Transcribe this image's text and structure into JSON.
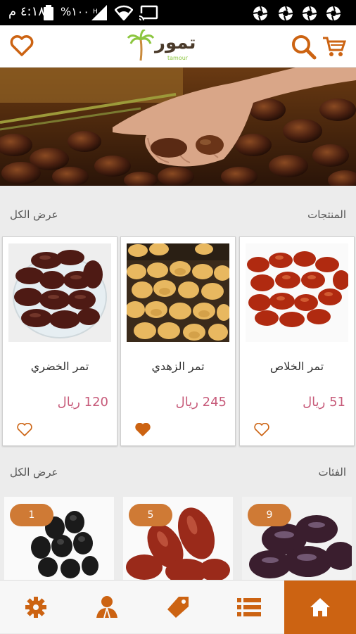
{
  "status_bar": {
    "time": "٤:١٨ م",
    "battery_text": "%١٠٠",
    "icons": [
      "signal-icon",
      "wifi-icon",
      "cast-icon",
      "battery-icon",
      "aperture-icon"
    ]
  },
  "header": {
    "logo_text": "تمور",
    "logo_subtext": "tamour",
    "icons": [
      "heart-icon",
      "search-icon",
      "cart-icon"
    ]
  },
  "products": {
    "title": "المنتجات",
    "view_all": "عرض الكل",
    "items": [
      {
        "name": "تمر الخلاص",
        "price": "51 ريال",
        "favorite": false
      },
      {
        "name": "تمر الزهدي",
        "price": "245 ريال",
        "favorite": true
      },
      {
        "name": "تمر الخضري",
        "price": "120 ريال",
        "favorite": false
      }
    ]
  },
  "categories": {
    "title": "الفئات",
    "view_all": "عرض الكل",
    "items": [
      {
        "count": "9"
      },
      {
        "count": "5"
      },
      {
        "count": "1"
      }
    ]
  },
  "bottom_nav": {
    "items": [
      "home-icon",
      "list-icon",
      "tag-icon",
      "user-icon",
      "gear-icon"
    ],
    "active": "home-icon"
  },
  "colors": {
    "accent": "#cc6312",
    "price": "#c75b7a",
    "badge": "#cf7a35"
  }
}
